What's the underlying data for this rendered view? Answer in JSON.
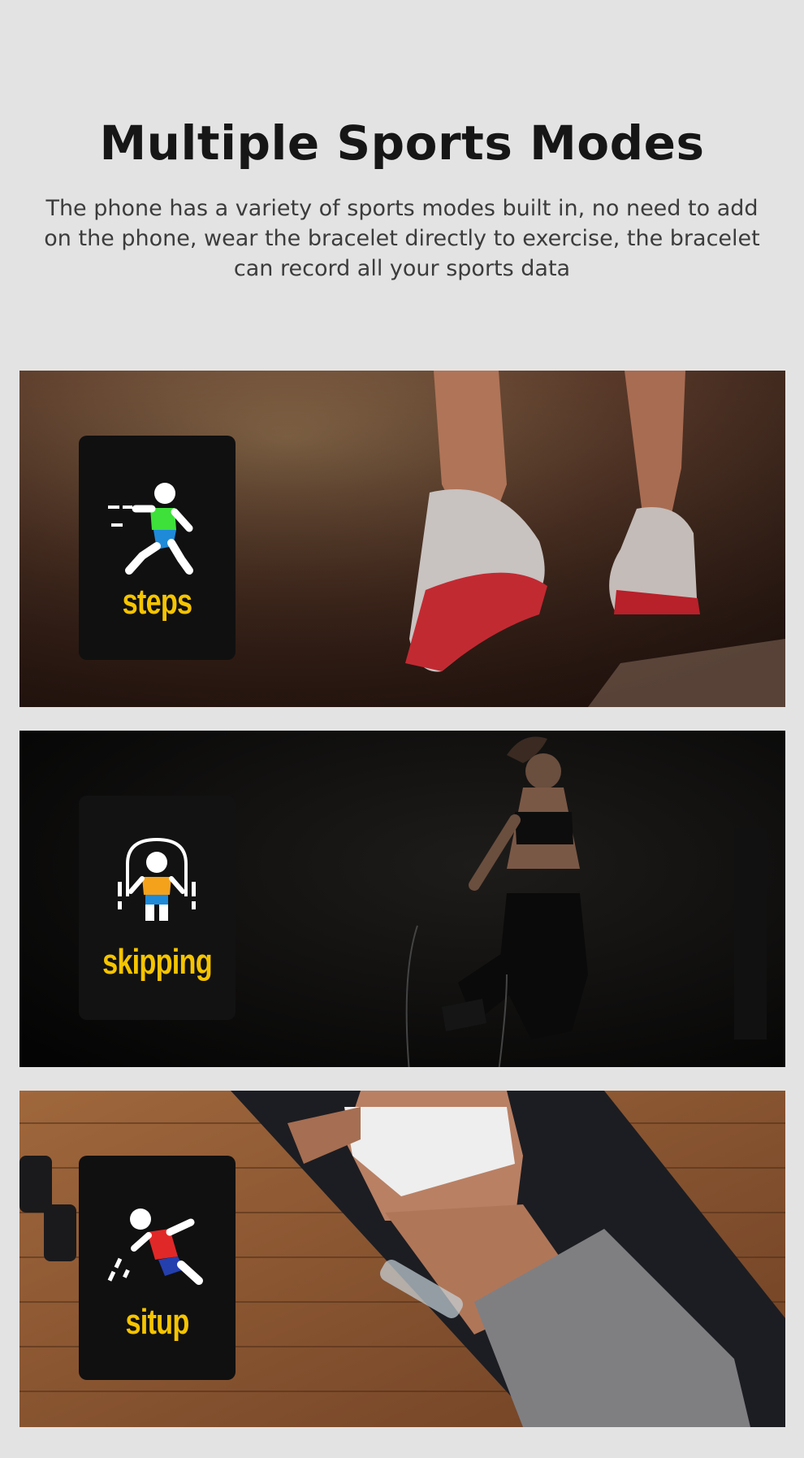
{
  "header": {
    "title": "Multiple Sports Modes",
    "description": "The phone has a variety of sports modes built in, no need to add on the phone, wear the bracelet directly to exercise, the bracelet can record all your sports data"
  },
  "modes": [
    {
      "label": "steps",
      "icon": "running-person-icon",
      "scene": "running-shoes-on-track"
    },
    {
      "label": "skipping",
      "icon": "jump-rope-icon",
      "scene": "woman-jumping-rope"
    },
    {
      "label": "situp",
      "icon": "situp-person-icon",
      "scene": "woman-on-yoga-mat"
    }
  ],
  "colors": {
    "page_background": "#e3e3e3",
    "label_yellow": "#f5c400",
    "card_background": "#101010"
  }
}
